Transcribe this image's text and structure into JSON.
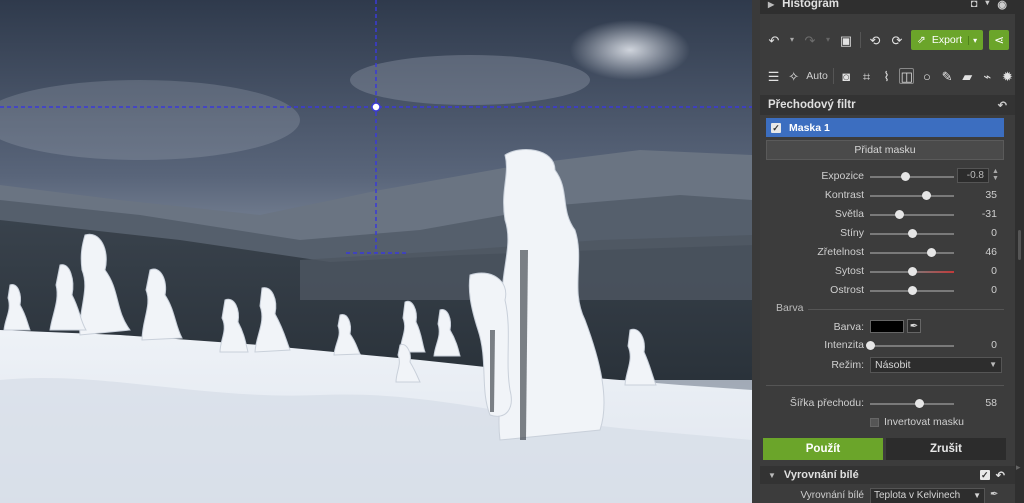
{
  "histogram": {
    "title": "Histogram"
  },
  "toolbar": {
    "export_label": "Export",
    "auto_label": "Auto"
  },
  "gradient_filter": {
    "title": "Přechodový filtr",
    "mask_name": "Maska 1",
    "add_mask_label": "Přidat masku",
    "sliders": [
      {
        "label": "Expozice",
        "value": "-0.8",
        "fraction": 0.42
      },
      {
        "label": "Kontrast",
        "value": "35",
        "fraction": 0.67
      },
      {
        "label": "Světla",
        "value": "-31",
        "fraction": 0.35
      },
      {
        "label": "Stíny",
        "value": "0",
        "fraction": 0.5
      },
      {
        "label": "Zřetelnost",
        "value": "46",
        "fraction": 0.73
      },
      {
        "label": "Sytost",
        "value": "0",
        "fraction": 0.5
      },
      {
        "label": "Ostrost",
        "value": "0",
        "fraction": 0.5
      }
    ],
    "color_group_label": "Barva",
    "color_label": "Barva:",
    "color_value": "#000000",
    "intensity_label": "Intenzita",
    "intensity_value": "0",
    "intensity_fraction": 0.0,
    "mode_label": "Režim:",
    "mode_value": "Násobit",
    "width_label": "Šířka přechodu:",
    "width_value": "58",
    "width_fraction": 0.58,
    "invert_label": "Invertovat masku",
    "apply_label": "Použít",
    "cancel_label": "Zrušit"
  },
  "white_balance": {
    "title": "Vyrovnání bílé",
    "row_label": "Vyrovnání bílé",
    "row_value": "Teplota v Kelvinech"
  },
  "colors": {
    "accent_green": "#6ba52a",
    "selection_blue": "#3c6ec0",
    "guide_color": "#3a3ad8",
    "saturation_track": "#c23a3a"
  }
}
